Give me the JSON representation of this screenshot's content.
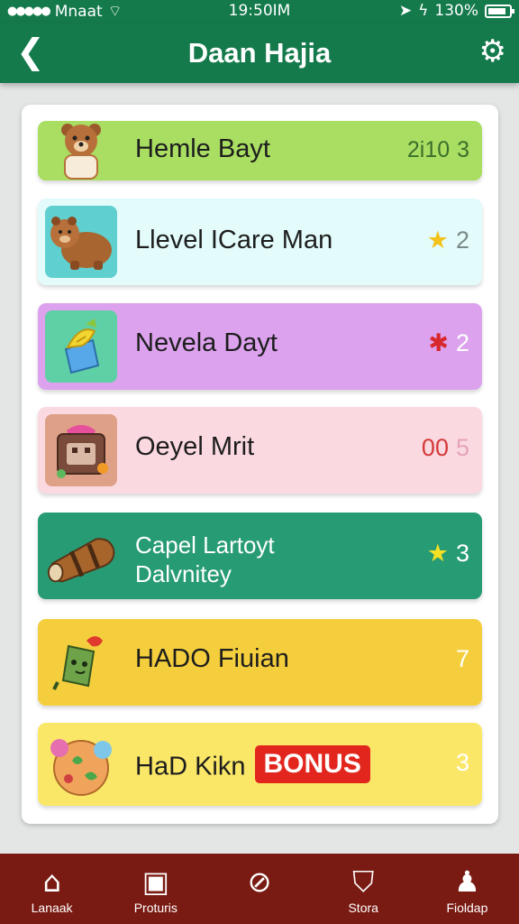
{
  "status_bar": {
    "carrier": "Mnaat",
    "time": "19:50IM",
    "battery": "130%",
    "battery_level": 0.85
  },
  "app_bar": {
    "title": "Daan Hajia",
    "back_icon": "back-arrow-icon",
    "settings_icon": "gear-icon"
  },
  "rows": [
    {
      "label": "Hemle Bayt",
      "value": "2i10",
      "value2": "3",
      "icon": "bear-icon",
      "color": "#a9de62"
    },
    {
      "label": "Llevel ICare Man",
      "value": "2",
      "icon": "bear-icon",
      "badge_icon": "star-icon",
      "color": "#e3fbfb"
    },
    {
      "label": "Nevela Dayt",
      "value": "2",
      "icon": "gift-bag-icon",
      "badge_icon": "star-icon",
      "color": "#dca2ee"
    },
    {
      "label": "Oeyel  Mrit",
      "value": "00",
      "value2": "5",
      "icon": "treasure-box-icon",
      "color": "#fbd9e1"
    },
    {
      "label": "Capel Lartoyt",
      "label2": "Dalvnitey",
      "value": "3",
      "icon": "log-icon",
      "badge_icon": "star-icon",
      "color": "#279b74"
    },
    {
      "label": "HADO Fiuian",
      "value": "7",
      "icon": "cactus-icon",
      "color": "#f4ce3d"
    },
    {
      "label": "HaD Kikn",
      "badge": "BONUS",
      "value": "3",
      "icon": "flower-bowl-icon",
      "color": "#fae768"
    }
  ],
  "bottom_nav": [
    {
      "label": "Lanaak",
      "icon": "home-icon"
    },
    {
      "label": "Proturis",
      "icon": "window-icon"
    },
    {
      "label": "",
      "icon": "compass-icon"
    },
    {
      "label": "Stora",
      "icon": "shield-icon"
    },
    {
      "label": "Fioldap",
      "icon": "person-icon"
    }
  ]
}
